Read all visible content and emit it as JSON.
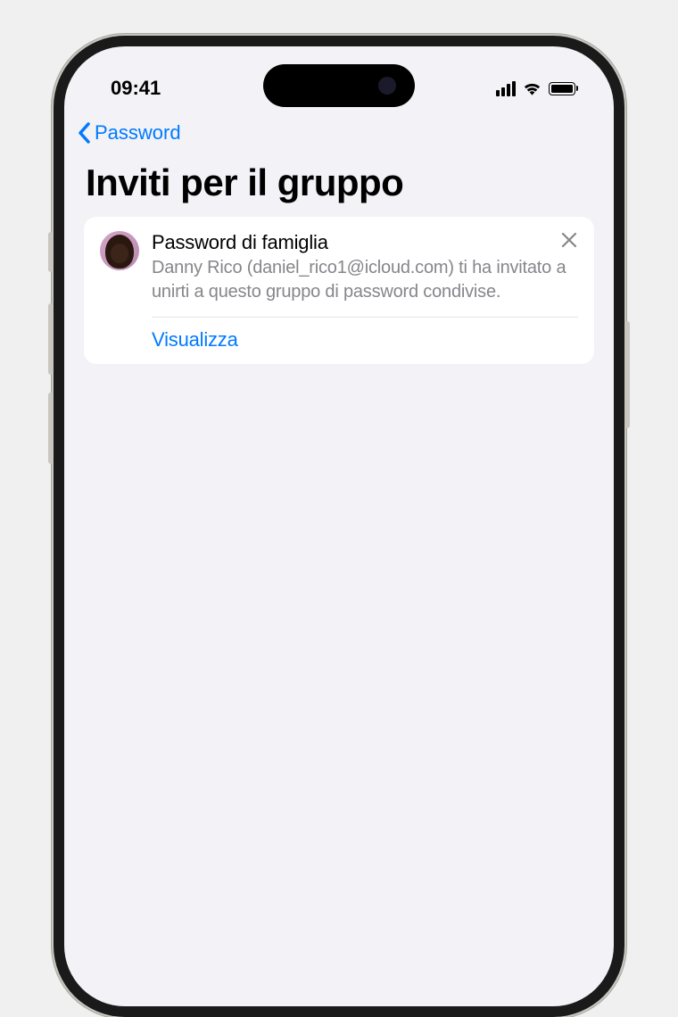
{
  "statusBar": {
    "time": "09:41"
  },
  "nav": {
    "backLabel": "Password"
  },
  "page": {
    "title": "Inviti per il gruppo"
  },
  "invite": {
    "groupName": "Password di famiglia",
    "description": "Danny Rico (daniel_rico1@icloud.com) ti ha invitato a unirti a questo gruppo di password condivise.",
    "actionLabel": "Visualizza"
  }
}
